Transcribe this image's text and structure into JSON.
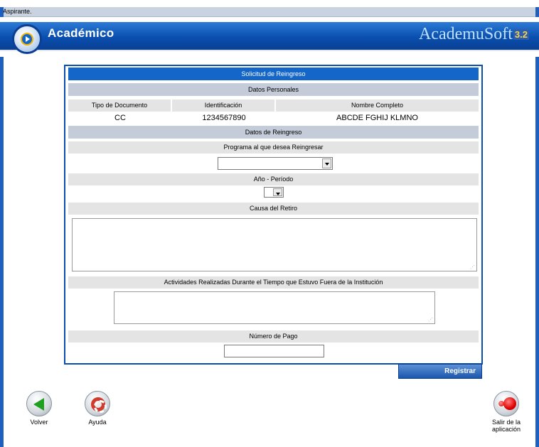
{
  "topbar": {
    "text": "Aspirante."
  },
  "header": {
    "app_title": "Académico",
    "brand": "AcademuSoft",
    "version": "3.2"
  },
  "form": {
    "title": "Solicitud de Reingreso",
    "personal_section": "Datos Personales",
    "columns": [
      "Tipo de Documento",
      "Identificación",
      "Nombre Completo"
    ],
    "values": [
      "CC",
      "1234567890",
      "ABCDE FGHIJ KLMNO"
    ],
    "reingreso_section": "Datos de Reingreso",
    "programa_label": "Programa al que desea Reingresar",
    "programa_value": "",
    "periodo_label": "Año - Período",
    "periodo_value": "",
    "causa_label": "Causa del Retiro",
    "causa_value": "",
    "actividades_label": "Actividades Realizadas Durante el Tiempo que Estuvo Fuera de la Institución",
    "actividades_value": "",
    "pago_label": "Número de Pago",
    "pago_value": ""
  },
  "buttons": {
    "registrar": "Registrar",
    "volver": "Volver",
    "ayuda": "Ayuda",
    "salir_line1": "Salir de la",
    "salir_line2": "aplicación"
  },
  "icons": {
    "volver": "left-arrow-icon",
    "ayuda": "lifebuoy-icon",
    "salir": "exit-icon",
    "logo": "play-logo-icon"
  },
  "colors": {
    "header_blue": "#0a4faf",
    "title_blue": "#1467c8",
    "section_gray": "#c3ccd8",
    "subsection_gray": "#e4e4e4"
  }
}
